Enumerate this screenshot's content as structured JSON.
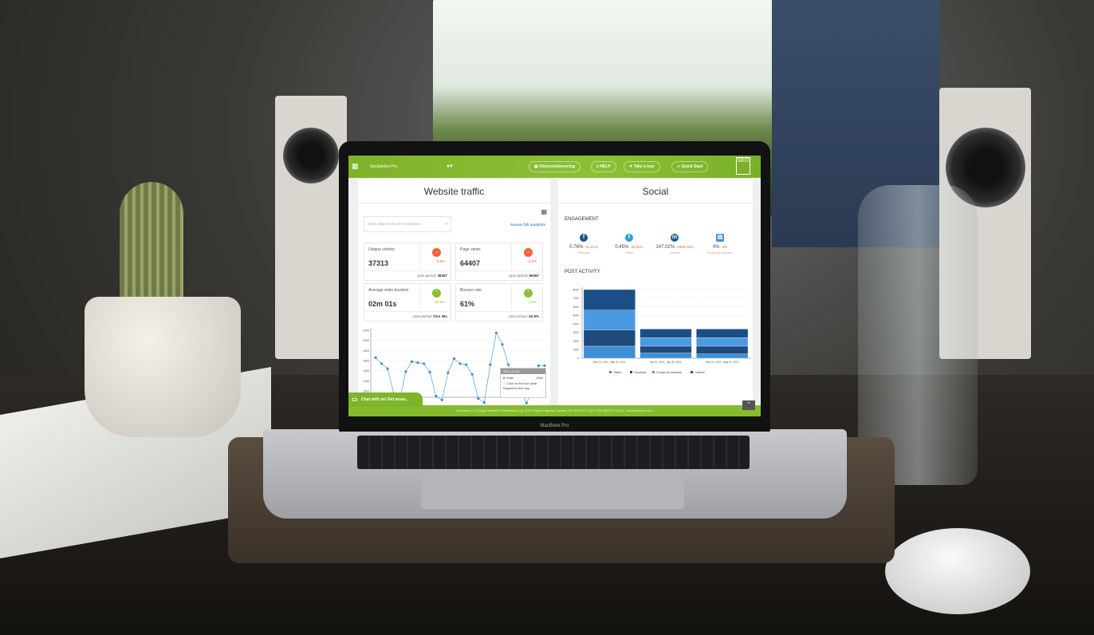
{
  "device_label": "MacBook Pro",
  "header": {
    "app_name": "SeoSamba Pro",
    "buttons": [
      {
        "label": "Videoconferencing",
        "icon": "video-icon"
      },
      {
        "label": "HELP",
        "icon": "help-icon"
      },
      {
        "label": "Take a tour",
        "icon": "star-icon"
      },
      {
        "label": "Quick Start",
        "icon": "rocket-icon"
      }
    ],
    "logo_text": "SEO"
  },
  "traffic": {
    "title": "Website traffic",
    "dropdown_placeholder": "Show data across all my projects",
    "analytics_link": "Access full analytics",
    "prev_label": "prev period:",
    "cards": [
      {
        "label": "Unique visitors",
        "value": "37313",
        "change": "-3.8%",
        "prev": "38387",
        "trend": "down"
      },
      {
        "label": "Page views",
        "value": "64407",
        "change": "-3.3%",
        "prev": "66087",
        "trend": "down"
      },
      {
        "label": "Average visits duration",
        "value": "02m 01s",
        "change": "25.8%",
        "prev": "01m 36s",
        "trend": "up"
      },
      {
        "label": "Bounce rate",
        "value": "61%",
        "change": "1.9%",
        "prev": "62.9%",
        "trend": "up"
      }
    ],
    "tooltip": {
      "date": "2021-03-30",
      "series": "Visits",
      "value": "1556",
      "hint": "Click to find out what happened this day."
    },
    "colors": {
      "down": "#f0643c",
      "up": "#8cc035",
      "line": "#3a8fd6"
    }
  },
  "social": {
    "title": "Social",
    "engagement_label": "ENGAGEMENT",
    "post_activity_label": "POST ACTIVITY",
    "engagement": [
      {
        "network": "Facebook",
        "value": "0.76%",
        "change": "-31.21%",
        "icon": "facebook-icon",
        "color": "#1d4f86"
      },
      {
        "network": "Twitter",
        "value": "0.45%",
        "change": "-32.25%",
        "icon": "twitter-icon",
        "color": "#2d9be0"
      },
      {
        "network": "LinkedIn",
        "value": "147.02%",
        "change": "-3388.29%",
        "icon": "linkedin-icon",
        "color": "#1d5c96"
      },
      {
        "network": "Google My Business",
        "value": "0%",
        "change": "-3%",
        "icon": "store-icon",
        "color": "#4a8fd8"
      }
    ]
  },
  "chat_label": "Chat with us! Get answ...",
  "footer_text": "SeoSamba 2.0. All rights reserved © SeoSamba Corp. 2140 S Dupont Highway, Camden, DE 19934 US +1 (877) 450-9894 EU +33 (0)... info@seosamba.com",
  "chart_data": [
    {
      "type": "line",
      "series": [
        {
          "name": "Visits",
          "values": [
            1660,
            1540,
            1440,
            950,
            820,
            1380,
            1580,
            1560,
            1540,
            1370,
            900,
            820,
            1360,
            1640,
            1540,
            1520,
            1330,
            850,
            770,
            1520,
            2150,
            1920,
            1520,
            1240,
            1000,
            760,
            1000,
            1500,
            1500
          ]
        }
      ],
      "yticks": [
        "2200",
        "2000",
        "1800",
        "1600",
        "1400",
        "1200",
        "1000"
      ],
      "ylim": [
        1000,
        2200
      ],
      "grid": true
    },
    {
      "type": "bar",
      "stacked": true,
      "categories": [
        "Mar 01, 2021 - Mar 31, 2021",
        "Apr 01, 2021 - Apr 30, 2021",
        "May 01, 2021 - May 31, 2021"
      ],
      "series": [
        {
          "name": "Twitter",
          "values": [
            1400,
            600,
            500
          ],
          "color": "#3d8fd6"
        },
        {
          "name": "Facebook",
          "values": [
            1900,
            800,
            900
          ],
          "color": "#1f4a7a"
        },
        {
          "name": "Google my business",
          "values": [
            2300,
            1000,
            1000
          ],
          "color": "#4a9ae0"
        },
        {
          "name": "LinkedIn",
          "values": [
            2400,
            1000,
            1000
          ],
          "color": "#1b4e86"
        }
      ],
      "yticks": [
        "0",
        "1000",
        "2000",
        "3000",
        "4000",
        "5000",
        "6000",
        "7000",
        "8000"
      ],
      "ylim": [
        0,
        8000
      ],
      "legend": "bottom",
      "grid": true
    }
  ]
}
